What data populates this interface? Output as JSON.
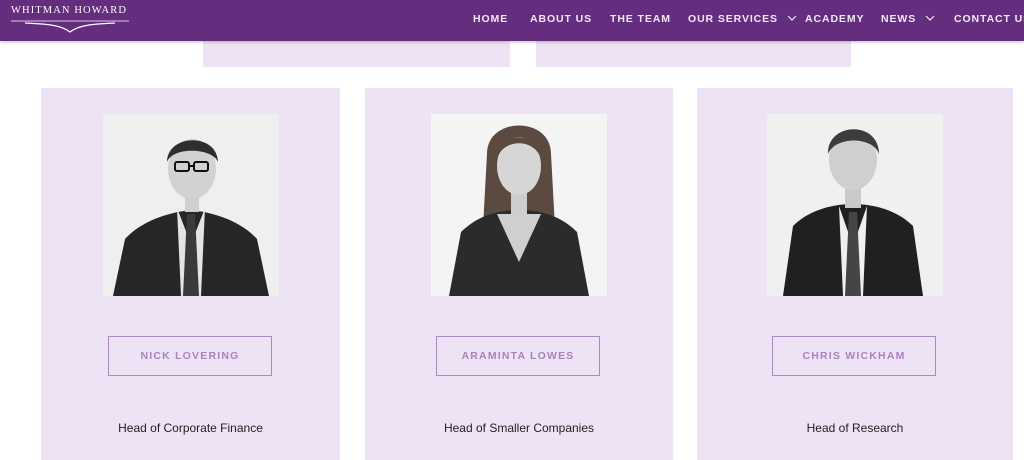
{
  "brand": {
    "name": "WHITMAN HOWARD"
  },
  "nav": {
    "items": [
      {
        "label": "HOME",
        "has_dropdown": false
      },
      {
        "label": "ABOUT US",
        "has_dropdown": false
      },
      {
        "label": "THE TEAM",
        "has_dropdown": false
      },
      {
        "label": "OUR SERVICES",
        "has_dropdown": true
      },
      {
        "label": "ACADEMY",
        "has_dropdown": false
      },
      {
        "label": "NEWS",
        "has_dropdown": true
      },
      {
        "label": "CONTACT US",
        "has_dropdown": false
      }
    ]
  },
  "team": [
    {
      "name": "NICK LOVERING",
      "role": "Head of Corporate Finance"
    },
    {
      "name": "ARAMINTA LOWES",
      "role": "Head of Smaller Companies"
    },
    {
      "name": "CHRIS WICKHAM",
      "role": "Head of Research"
    }
  ],
  "colors": {
    "header_bg": "#652d7e",
    "card_bg": "#ede3f4",
    "button_text": "#a783c0",
    "button_border": "#a98bc0"
  },
  "icons": {
    "dropdown": "chevron-down-icon"
  }
}
